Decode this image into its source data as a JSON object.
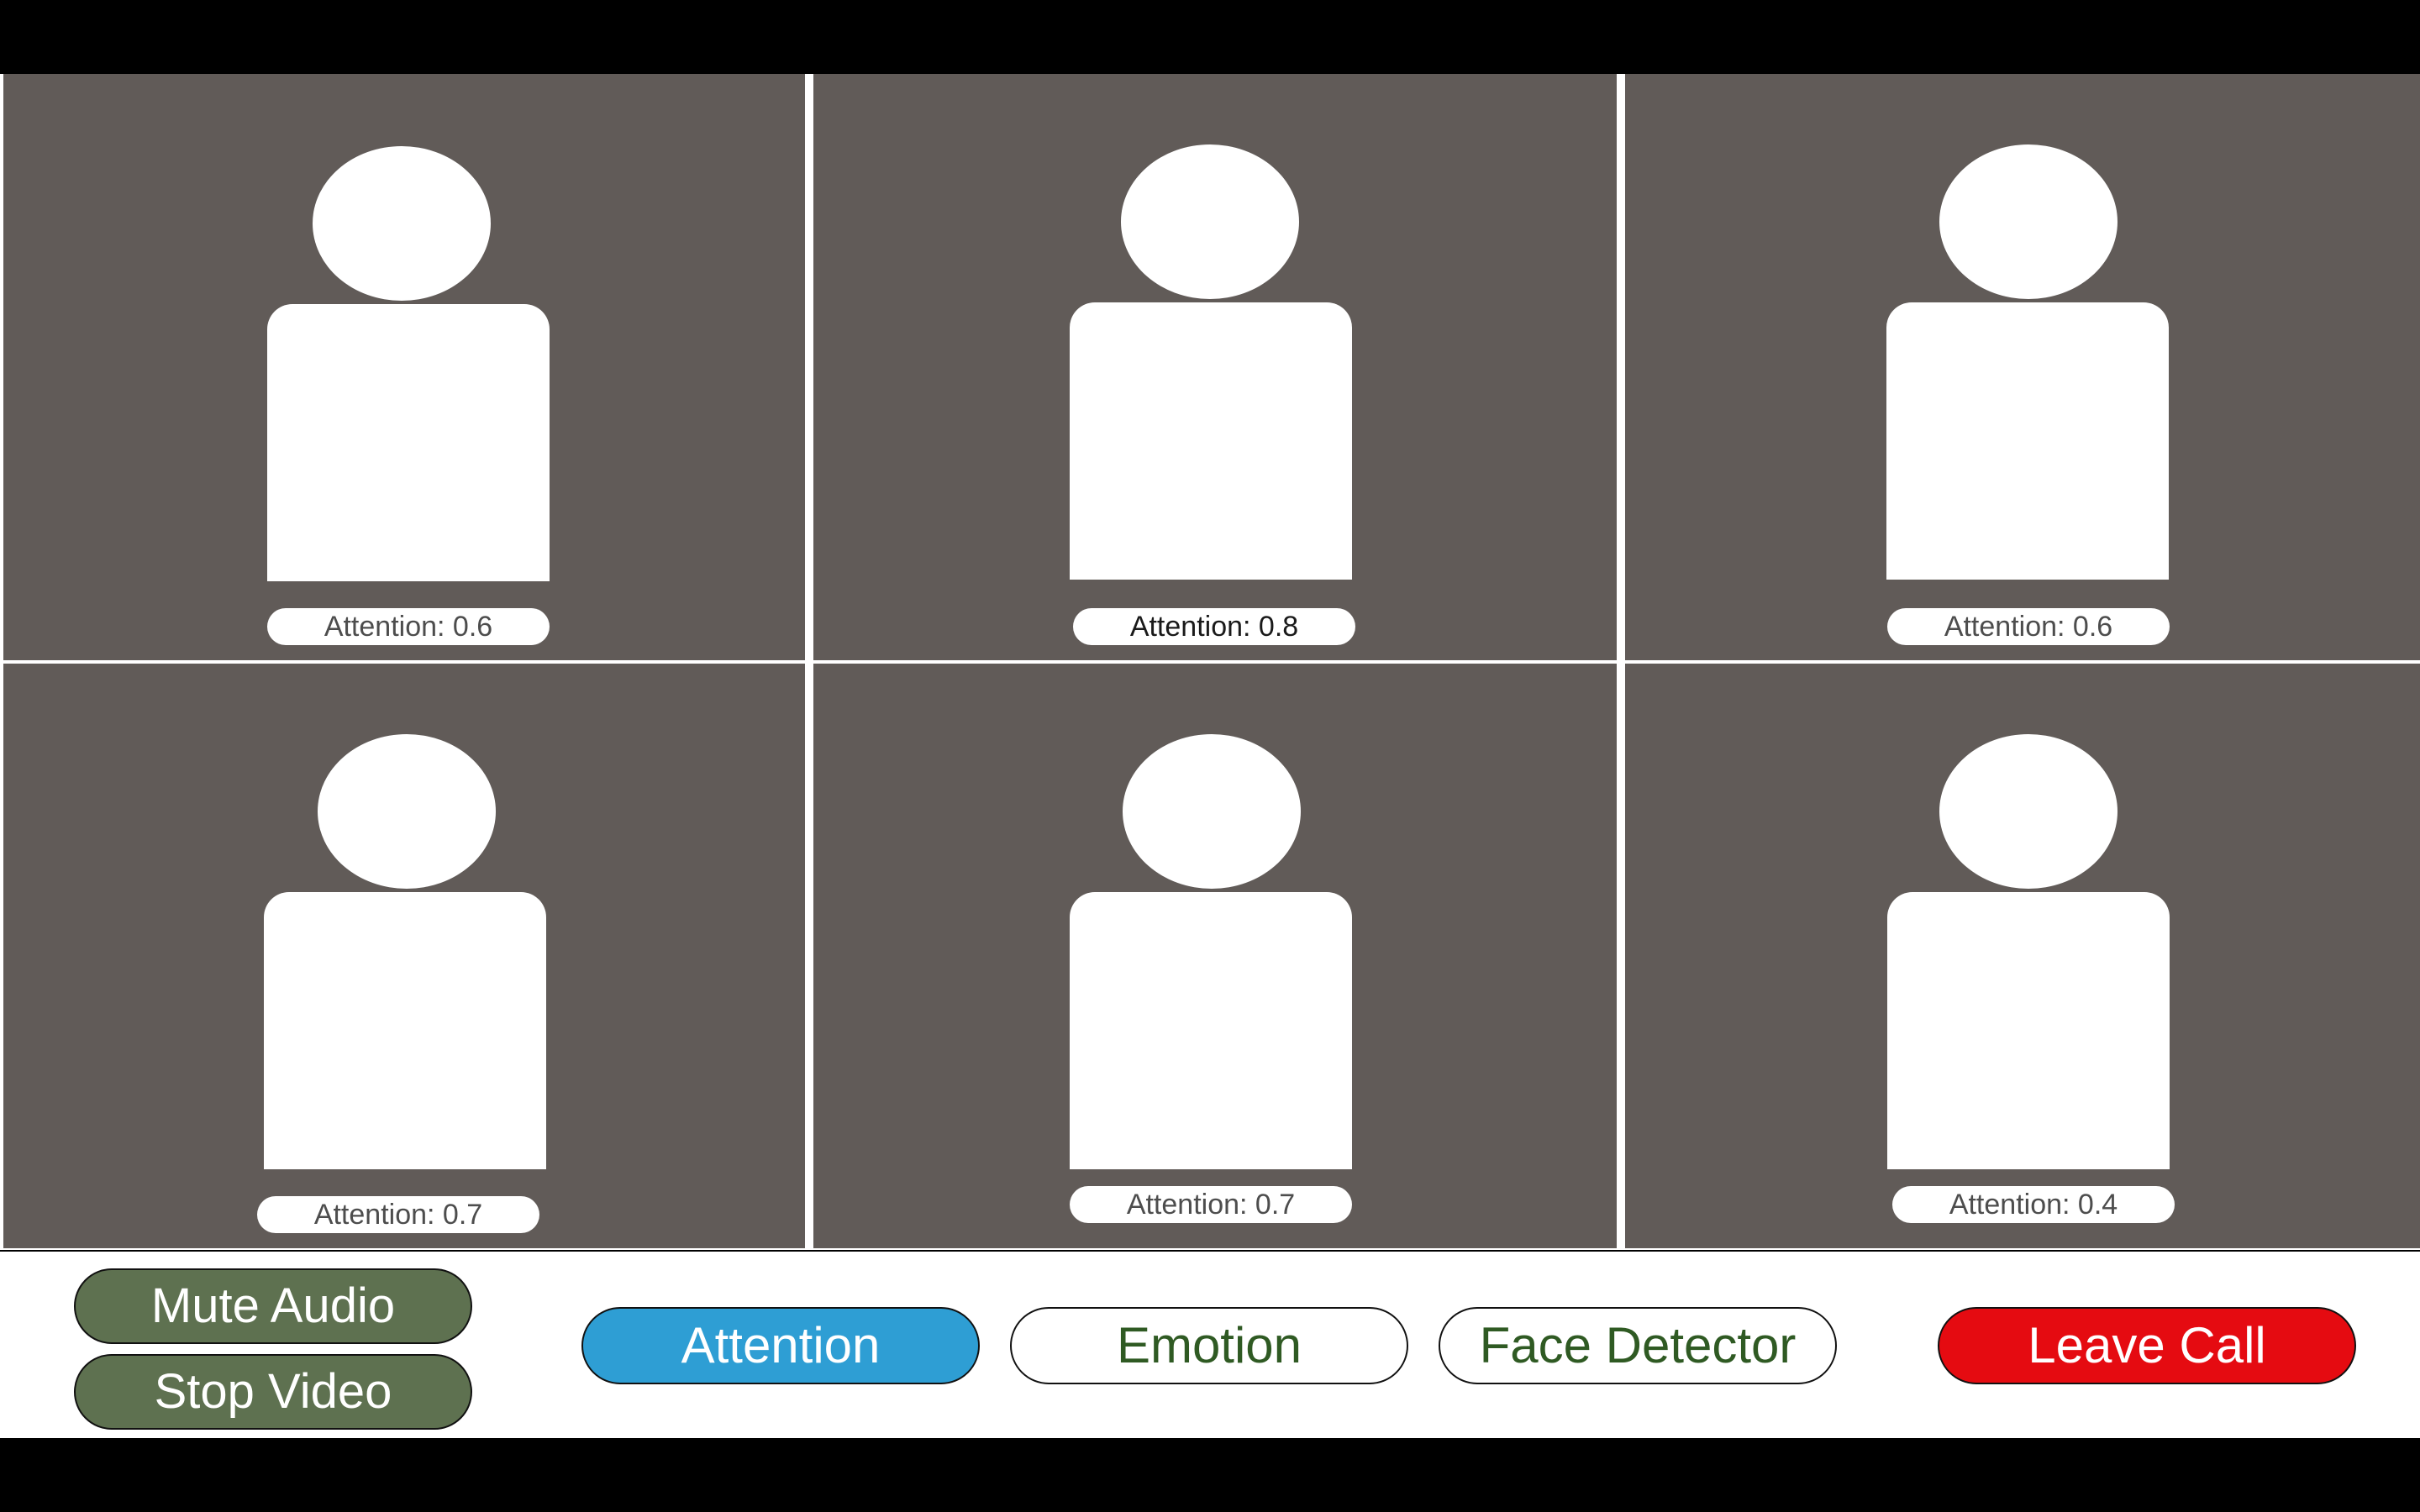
{
  "participants": [
    {
      "attention_label": "Attention: 0.6"
    },
    {
      "attention_label": "Attention: 0.8"
    },
    {
      "attention_label": "Attention: 0.6"
    },
    {
      "attention_label": "Attention: 0.7"
    },
    {
      "attention_label": "Attention: 0.7"
    },
    {
      "attention_label": "Attention: 0.4"
    }
  ],
  "controls": {
    "mute_audio": "Mute Audio",
    "stop_video": "Stop Video",
    "attention": "Attention",
    "emotion": "Emotion",
    "face_detector": "Face Detector",
    "leave_call": "Leave Call",
    "active_mode": "Attention"
  },
  "colors": {
    "tile_background": "#615b58",
    "av_button": "#5e7150",
    "active_mode_button": "#2e9ed4",
    "mode_text": "#2f5a23",
    "leave_button": "#e50b11"
  }
}
